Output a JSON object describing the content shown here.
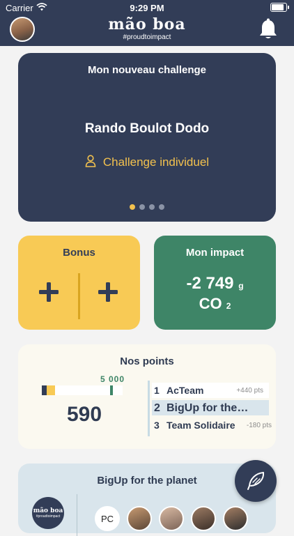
{
  "status_bar": {
    "carrier": "Carrier",
    "time": "9:29 PM",
    "battery_level": 0.95
  },
  "header": {
    "brand": "mão boa",
    "tagline": "#proudtoimpact",
    "icons": [
      "avatar",
      "bell-icon"
    ]
  },
  "challenge": {
    "heading": "Mon nouveau challenge",
    "name": "Rando Boulot Dodo",
    "type": "Challenge individuel",
    "carousel": {
      "pages": 4,
      "active": 1
    }
  },
  "bonus": {
    "heading": "Bonus",
    "actions": [
      "plus-icon",
      "plus-icon"
    ]
  },
  "impact": {
    "heading": "Mon impact",
    "value": "-2 749",
    "unit": "g",
    "co": "CO",
    "co_sub": "2"
  },
  "points": {
    "heading": "Nos points",
    "goal": "5 000",
    "total": "590",
    "progress": 0.118,
    "ranking": [
      {
        "rank": "1",
        "team": "AcTeam",
        "delta": "+440 pts"
      },
      {
        "rank": "2",
        "team": "BigUp for the planet",
        "delta": ""
      },
      {
        "rank": "3",
        "team": "Team Solidaire",
        "delta": "-180 pts"
      }
    ]
  },
  "bigup": {
    "heading": "BigUp for the planet",
    "logo_title": "mão boa",
    "logo_tag": "#proudtoimpact",
    "members": [
      "PC"
    ]
  },
  "colors": {
    "navy": "#323d57",
    "yellow": "#f8ca55",
    "green": "#3e8567",
    "cream": "#fbf9f0",
    "light_blue": "#d9e5ec"
  }
}
